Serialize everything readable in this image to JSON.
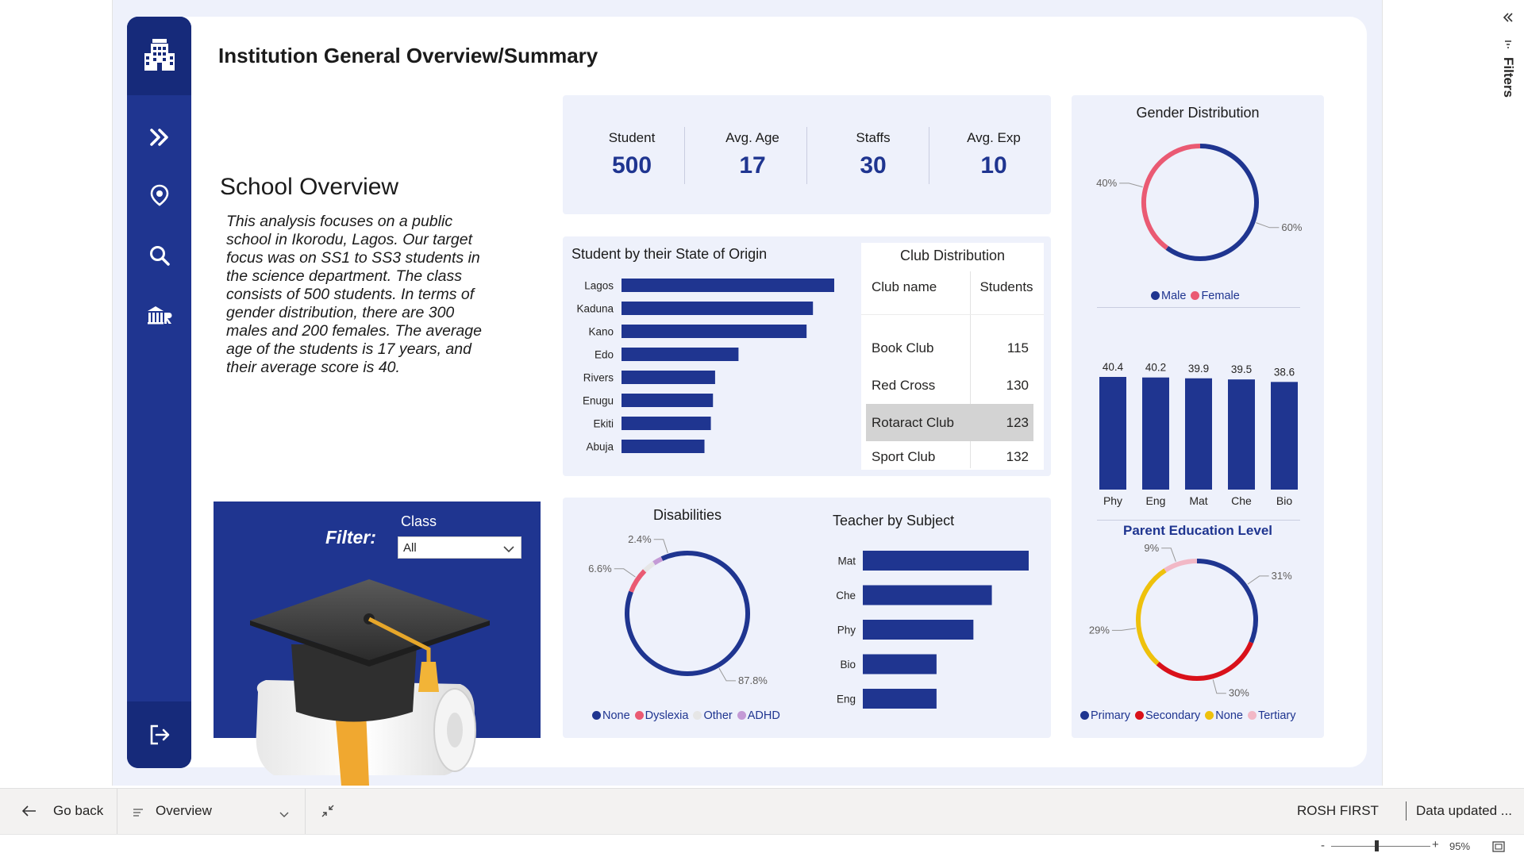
{
  "report": {
    "title": "Institution General Overview/Summary",
    "overview_title": "School Overview",
    "overview_text": "This analysis focuses on a public school in Ikorodu, Lagos. Our target focus was on SS1 to SS3 students in the science department. The class consists of 500 students. In terms of gender distribution, there are 300 males and 200 females. The average age of the students is 17 years, and their average score is 40."
  },
  "nav": {
    "items": [
      "building-icon",
      "chevrons-right-icon",
      "location-pin-icon",
      "search-icon",
      "institution-icon",
      "sign-out-icon"
    ]
  },
  "filter": {
    "label": "Filter:",
    "class_label": "Class",
    "class_value": "All"
  },
  "kpis": [
    {
      "label": "Student",
      "value": "500"
    },
    {
      "label": "Avg. Age",
      "value": "17"
    },
    {
      "label": "Staffs",
      "value": "30"
    },
    {
      "label": "Avg. Exp",
      "value": "10"
    }
  ],
  "club_table": {
    "title": "Club Distribution",
    "headers": [
      "Club name",
      "Students"
    ],
    "rows": [
      {
        "name": "Book Club",
        "students": "115"
      },
      {
        "name": "Red Cross",
        "students": "130"
      },
      {
        "name": "Rotaract Club",
        "students": "123"
      },
      {
        "name": "Sport Club",
        "students": "132"
      }
    ]
  },
  "colors": {
    "navy": "#1f3590",
    "pink": "#ea5a73",
    "light_pink": "#f2b8c6",
    "lavender": "#c49ad6",
    "light_grey": "#e6e6e6",
    "red": "#d9111a",
    "yellow": "#eec10c"
  },
  "chart_data": [
    {
      "type": "bar",
      "orientation": "horizontal",
      "title": "Student by their State of Origin",
      "categories": [
        "Lagos",
        "Kaduna",
        "Kano",
        "Edo",
        "Rivers",
        "Enugu",
        "Ekiti",
        "Abuja"
      ],
      "values": [
        100,
        90,
        87,
        55,
        44,
        43,
        42,
        39
      ]
    },
    {
      "type": "pie",
      "title": "Gender Distribution",
      "labels": [
        "Male",
        "Female"
      ],
      "values": [
        60,
        40
      ],
      "display": [
        "60%",
        "40%"
      ]
    },
    {
      "type": "bar",
      "title": "",
      "categories": [
        "Phy",
        "Eng",
        "Mat",
        "Che",
        "Bio"
      ],
      "values": [
        40.4,
        40.2,
        39.9,
        39.5,
        38.6
      ]
    },
    {
      "type": "pie",
      "title": "Disabilities",
      "labels": [
        "None",
        "Dyslexia",
        "Other",
        "ADHD"
      ],
      "values": [
        87.8,
        6.6,
        3.2,
        2.4
      ],
      "display": [
        "87.8%",
        "6.6%",
        "",
        "2.4%"
      ]
    },
    {
      "type": "bar",
      "orientation": "horizontal",
      "title": "Teacher by Subject",
      "categories": [
        "Mat",
        "Che",
        "Phy",
        "Bio",
        "Eng"
      ],
      "values": [
        9,
        7,
        6,
        4,
        4
      ]
    },
    {
      "type": "pie",
      "title": "Parent Education Level",
      "labels": [
        "Primary",
        "Secondary",
        "None",
        "Tertiary"
      ],
      "values": [
        31,
        30,
        29,
        9
      ],
      "display": [
        "31%",
        "30%",
        "29%",
        "9%"
      ]
    }
  ],
  "bottom_bar": {
    "go_back": "Go back",
    "page": "Overview",
    "author": "ROSH FIRST",
    "updated": "Data updated ...",
    "zoom": "95%",
    "filters": "Filters"
  }
}
